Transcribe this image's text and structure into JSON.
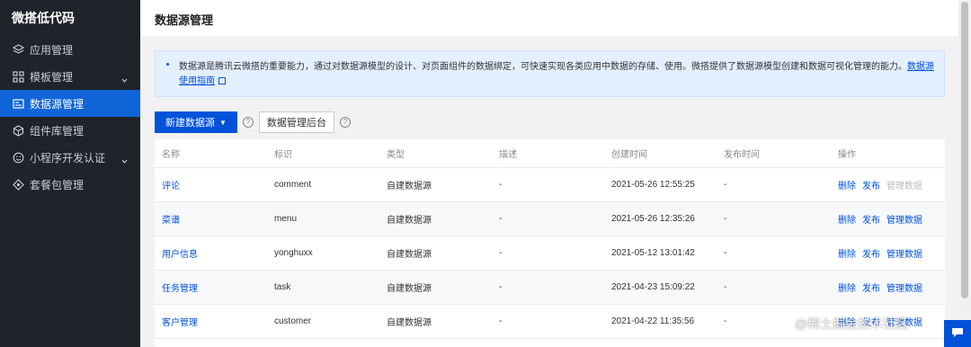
{
  "app": {
    "brand": "微搭低代码"
  },
  "sidebar": {
    "items": [
      {
        "label": "应用管理",
        "icon": "layers-icon",
        "active": false
      },
      {
        "label": "模板管理",
        "icon": "template-grid-icon",
        "active": false,
        "has_children": true
      },
      {
        "label": "数据源管理",
        "icon": "datasource-icon",
        "active": true
      },
      {
        "label": "组件库管理",
        "icon": "component-icon",
        "active": false
      },
      {
        "label": "小程序开发认证",
        "icon": "smiley-icon",
        "active": false,
        "has_children": true
      },
      {
        "label": "套餐包管理",
        "icon": "package-icon",
        "active": false
      }
    ]
  },
  "page": {
    "title": "数据源管理"
  },
  "notice": {
    "text": "数据源是腾讯云微搭的重要能力，通过对数据源模型的设计、对页面组件的数据绑定，可快速实现各类应用中数据的存储、使用。微搭提供了数据源模型创建和数据可视化管理的能力。",
    "link_label": "数据源使用指南"
  },
  "toolbar": {
    "new_datasource_label": "新建数据源",
    "admin_label": "数据管理后台"
  },
  "table": {
    "columns": [
      "名称",
      "标识",
      "类型",
      "描述",
      "创建时间",
      "发布时间",
      "操作"
    ],
    "rows": [
      {
        "name": "评论",
        "id": "comment",
        "type": "自建数据源",
        "desc": "-",
        "created": "2021-05-26 12:55:25",
        "published": "-",
        "ops": [
          "删除",
          "发布",
          "管理数据"
        ],
        "manage_disabled": true
      },
      {
        "name": "菜谱",
        "id": "menu",
        "type": "自建数据源",
        "desc": "-",
        "created": "2021-05-26 12:35:26",
        "published": "-",
        "ops": [
          "删除",
          "发布",
          "管理数据"
        ],
        "manage_disabled": false
      },
      {
        "name": "用户信息",
        "id": "yonghuxx",
        "type": "自建数据源",
        "desc": "-",
        "created": "2021-05-12 13:01:42",
        "published": "-",
        "ops": [
          "删除",
          "发布",
          "管理数据"
        ],
        "manage_disabled": false
      },
      {
        "name": "任务管理",
        "id": "task",
        "type": "自建数据源",
        "desc": "-",
        "created": "2021-04-23 15:09:22",
        "published": "-",
        "ops": [
          "删除",
          "发布",
          "管理数据"
        ],
        "manage_disabled": false
      },
      {
        "name": "客户管理",
        "id": "customer",
        "type": "自建数据源",
        "desc": "-",
        "created": "2021-04-22 11:35:56",
        "published": "-",
        "ops": [
          "删除",
          "发布",
          "管理数据"
        ],
        "manage_disabled": false
      }
    ]
  },
  "watermark": "@稀土掘金技术社区",
  "colors": {
    "sidebar_bg": "#20232a",
    "accent": "#0052d9",
    "notice_bg": "#e4efff"
  }
}
